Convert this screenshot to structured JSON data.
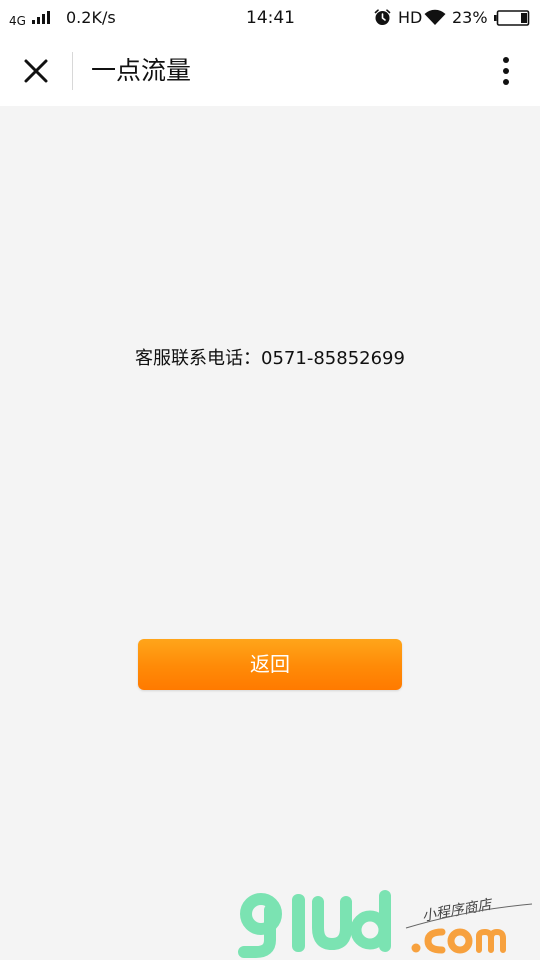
{
  "status_bar": {
    "network": "4G",
    "speed": "0.2K/s",
    "time": "14:41",
    "hd": "HD",
    "battery_percent": "23%",
    "battery_level": 0.23,
    "icons": [
      "signal-icon",
      "alarm-icon",
      "wifi-icon",
      "battery-icon"
    ]
  },
  "nav": {
    "title": "一点流量",
    "close_icon": "close-icon",
    "more_icon": "more-vertical-icon"
  },
  "main": {
    "service_text": "客服联系电话：0571-85852699",
    "back_label": "返回",
    "button_colors": [
      "#ffa51a",
      "#ff7a00"
    ]
  },
  "watermark": {
    "logo_text": "glud.com",
    "tagline": "小程序商店"
  },
  "colors": {
    "background": "#f4f4f4",
    "bar_background": "#ffffff",
    "accent": "#ff8a07",
    "watermark_green": "#7be3b2",
    "watermark_orange": "#f7a13e"
  }
}
